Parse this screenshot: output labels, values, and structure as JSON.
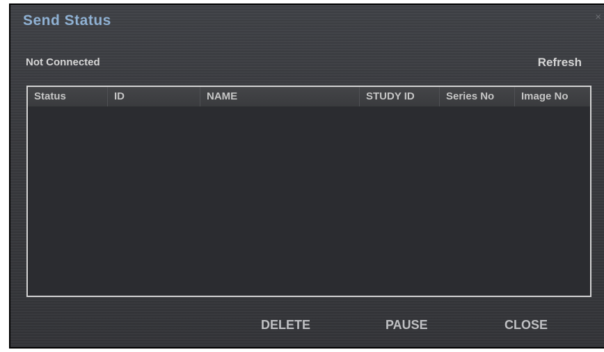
{
  "dialog": {
    "title": "Send Status",
    "close_icon": "close-icon",
    "close_glyph": "×"
  },
  "connection": {
    "status": "Not Connected"
  },
  "toolbar": {
    "refresh_label": "Refresh"
  },
  "table": {
    "columns": [
      "Status",
      "ID",
      "NAME",
      "STUDY ID",
      "Series No",
      "Image No"
    ],
    "rows": []
  },
  "footer": {
    "delete_label": "DELETE",
    "pause_label": "PAUSE",
    "close_label": "CLOSE"
  },
  "colors": {
    "title": "#8fb1d3",
    "dialog_bg": "#38393d",
    "table_bg": "#2b2c30",
    "table_border": "#d4d4d4"
  }
}
